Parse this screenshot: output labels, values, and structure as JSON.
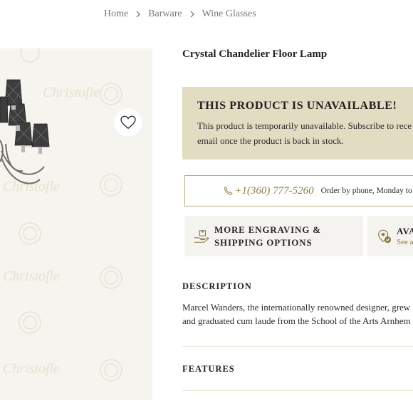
{
  "breadcrumb": {
    "items": [
      "Home",
      "Barware",
      "Wine Glasses"
    ]
  },
  "gallery": {
    "watermark": "Christofle",
    "favorite_icon": "heart-icon"
  },
  "product": {
    "title": "Crystal Chandelier Floor Lamp"
  },
  "notice": {
    "heading": "THIS PRODUCT IS UNAVAILABLE!",
    "line1": "This product is temporarily unavailable. Subscribe to rece",
    "line2": "email once the product is back in stock."
  },
  "contact": {
    "phone_icon": "phone-icon",
    "phone": "+1(360) 777-5260",
    "note": "Order by phone, Monday to F"
  },
  "options": [
    {
      "icon": "package-hand-icon",
      "line1": "MORE ENGRAVING &",
      "line2": "SHIPPING OPTIONS"
    },
    {
      "icon": "store-availability-icon",
      "line1": "AVA",
      "line2": "See a"
    }
  ],
  "description": {
    "heading": "DESCRIPTION",
    "line1": "Marcel Wanders, the internationally renowned designer, grew",
    "line2": "and graduated cum laude from the School of the Arts Arnhem"
  },
  "features": {
    "heading": "FEATURES"
  },
  "colors": {
    "accent": "#8b7d45",
    "notice_bg": "#e2dcc2",
    "gallery_bg": "#f6f4ee",
    "option_bg": "#f5f3ef"
  }
}
